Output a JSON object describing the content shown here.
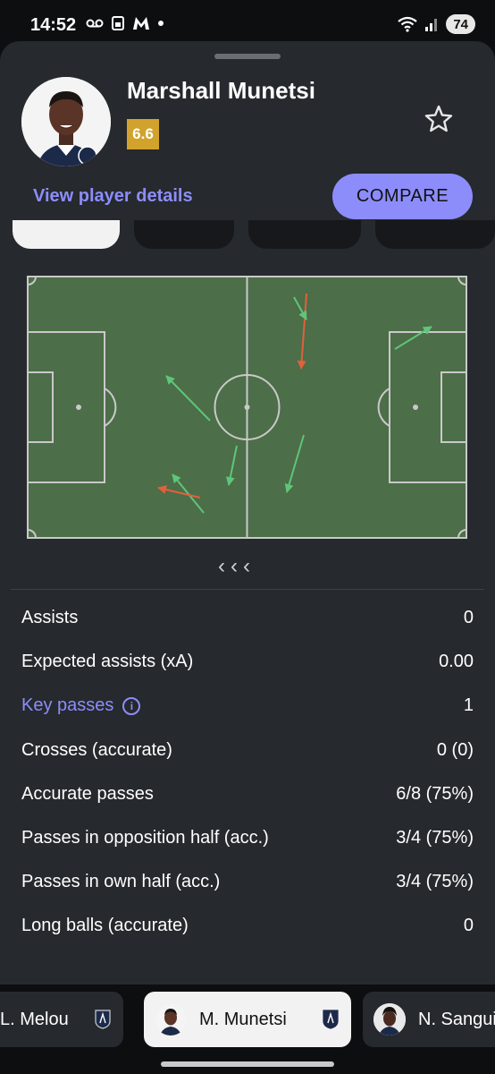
{
  "status_bar": {
    "time": "14:52",
    "battery": "74",
    "left_icons": [
      "voicemail-icon",
      "sim-icon",
      "m-app-icon",
      "dot-icon"
    ],
    "right_icons": [
      "wifi-icon",
      "signal-icon",
      "battery-icon"
    ]
  },
  "player": {
    "name": "Marshall Munetsi",
    "rating": "6.6",
    "rating_color": "#d1a32c",
    "details_link": "View player details",
    "compare_label": "COMPARE",
    "accent_color": "#8c8dfb"
  },
  "pass_map": {
    "pitch_color": "#4c6e48",
    "successful_color": "#5fc57b",
    "unsuccessful_color": "#e0613c"
  },
  "stats": [
    {
      "label": "Assists",
      "value": "0"
    },
    {
      "label": "Expected assists (xA)",
      "value": "0.00"
    },
    {
      "label": "Key passes",
      "value": "1",
      "link": true,
      "info_icon": "info-icon"
    },
    {
      "label": "Crosses (accurate)",
      "value": "0 (0)"
    },
    {
      "label": "Accurate passes",
      "value": "6/8 (75%)"
    },
    {
      "label": "Passes in opposition half (acc.)",
      "value": "3/4 (75%)"
    },
    {
      "label": "Passes in own half (acc.)",
      "value": "3/4 (75%)"
    },
    {
      "label": "Long balls (accurate)",
      "value": "0"
    }
  ],
  "player_switcher": [
    {
      "name": "L. Melou",
      "active": false
    },
    {
      "name": "M. Munetsi",
      "active": true
    },
    {
      "name": "N. Sangui",
      "active": false
    }
  ]
}
